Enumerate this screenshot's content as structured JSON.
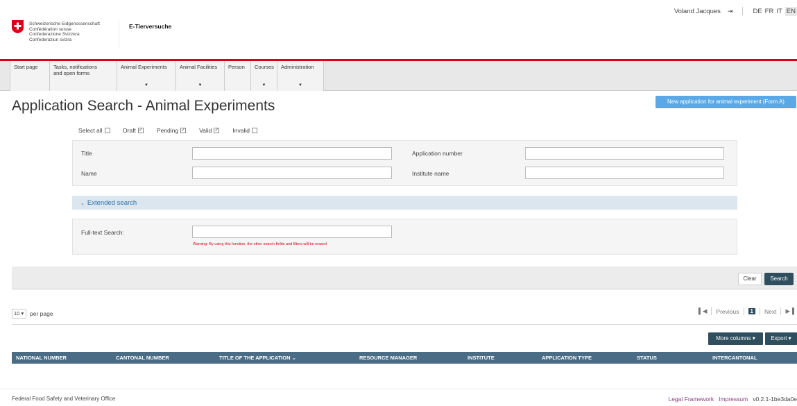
{
  "header": {
    "gov_lines": [
      "Schweizerische Eidgenossenschaft",
      "Confédération suisse",
      "Confederazione Svizzera",
      "Confederaziun svizra"
    ],
    "app_name": "E-Tierversuche",
    "user_name": "Voland Jacques",
    "logout_icon": "logout-icon",
    "languages": [
      "DE",
      "FR",
      "IT",
      "EN"
    ],
    "active_language": "EN"
  },
  "nav": {
    "items": [
      {
        "line1": "Start page",
        "line2": "",
        "has_caret": false
      },
      {
        "line1": "Tasks, notifications",
        "line2": "and open forms",
        "has_caret": false
      },
      {
        "line1": "Animal Experiments",
        "line2": "",
        "has_caret": true
      },
      {
        "line1": "Animal Facilities",
        "line2": "",
        "has_caret": true
      },
      {
        "line1": "Person",
        "line2": "",
        "has_caret": false
      },
      {
        "line1": "Courses",
        "line2": "",
        "has_caret": true
      },
      {
        "line1": "Administration",
        "line2": "",
        "has_caret": true
      }
    ]
  },
  "page": {
    "title": "Application Search - Animal Experiments",
    "new_app_button": "New application for animal experiment (Form A)"
  },
  "filters": [
    {
      "label": "Select all",
      "checked": false
    },
    {
      "label": "Draft",
      "checked": true
    },
    {
      "label": "Pending",
      "checked": true
    },
    {
      "label": "Valid",
      "checked": true
    },
    {
      "label": "Invalid",
      "checked": false
    }
  ],
  "search": {
    "title_label": "Title",
    "title_value": "",
    "name_label": "Name",
    "name_value": "",
    "app_number_label": "Application number",
    "app_number_value": "",
    "institute_label": "Institute name",
    "institute_value": "",
    "extended_label": "Extended search",
    "fulltext_label": "Full-text Search:",
    "fulltext_value": "",
    "warning": "Warning: By using this function, the other search fields and filters will be erased",
    "clear_button": "Clear",
    "search_button": "Search"
  },
  "pager": {
    "per_page_value": "10 ▾",
    "per_page_label": "per page",
    "first_icon": "first-page-icon",
    "previous": "Previous",
    "current_page": "1",
    "next": "Next",
    "last_icon": "last-page-icon"
  },
  "table": {
    "more_columns": "More columns ▾",
    "export": "Export ▾",
    "columns": [
      "NATIONAL NUMBER",
      "CANTONAL NUMBER",
      "TITLE OF THE APPLICATION ⌄",
      "RESOURCE MANAGER",
      "INSTITUTE",
      "APPLICATION TYPE",
      "STATUS",
      "INTERCANTONAL"
    ]
  },
  "footer": {
    "office": "Federal Food Safety and Veterinary Office",
    "legal": "Legal Framework",
    "impressum": "Impressum",
    "version": "v0.2.1-1be3da0e"
  },
  "colors": {
    "swiss_red": "#dc0018",
    "accent_blue": "#5aa9e6",
    "dark_button": "#2f4f5f",
    "table_header": "#4a6d85"
  }
}
